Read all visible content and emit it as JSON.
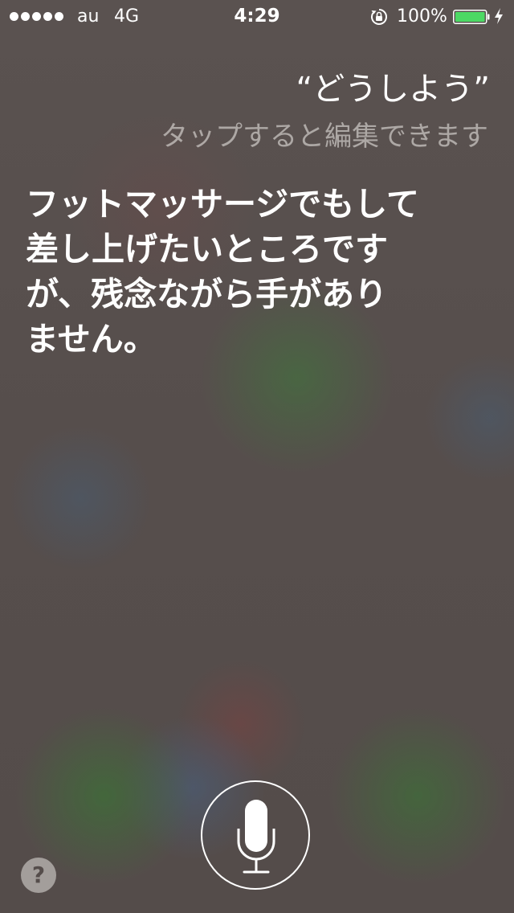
{
  "status_bar": {
    "carrier": "au",
    "network": "4G",
    "time": "4:29",
    "battery_percent": "100%",
    "battery_color": "#4cd964",
    "icons": [
      "signal-dots",
      "rotation-lock-icon",
      "battery-icon",
      "charging-bolt-icon"
    ]
  },
  "siri": {
    "query": "“どうしよう”",
    "edit_hint": "タップすると編集できます",
    "response_lines": [
      "フットマッサージでもして",
      "差し上げたいところです",
      "が、残念ながら手があり",
      "ません。"
    ],
    "mic_icon": "microphone-icon",
    "help_label": "?"
  }
}
